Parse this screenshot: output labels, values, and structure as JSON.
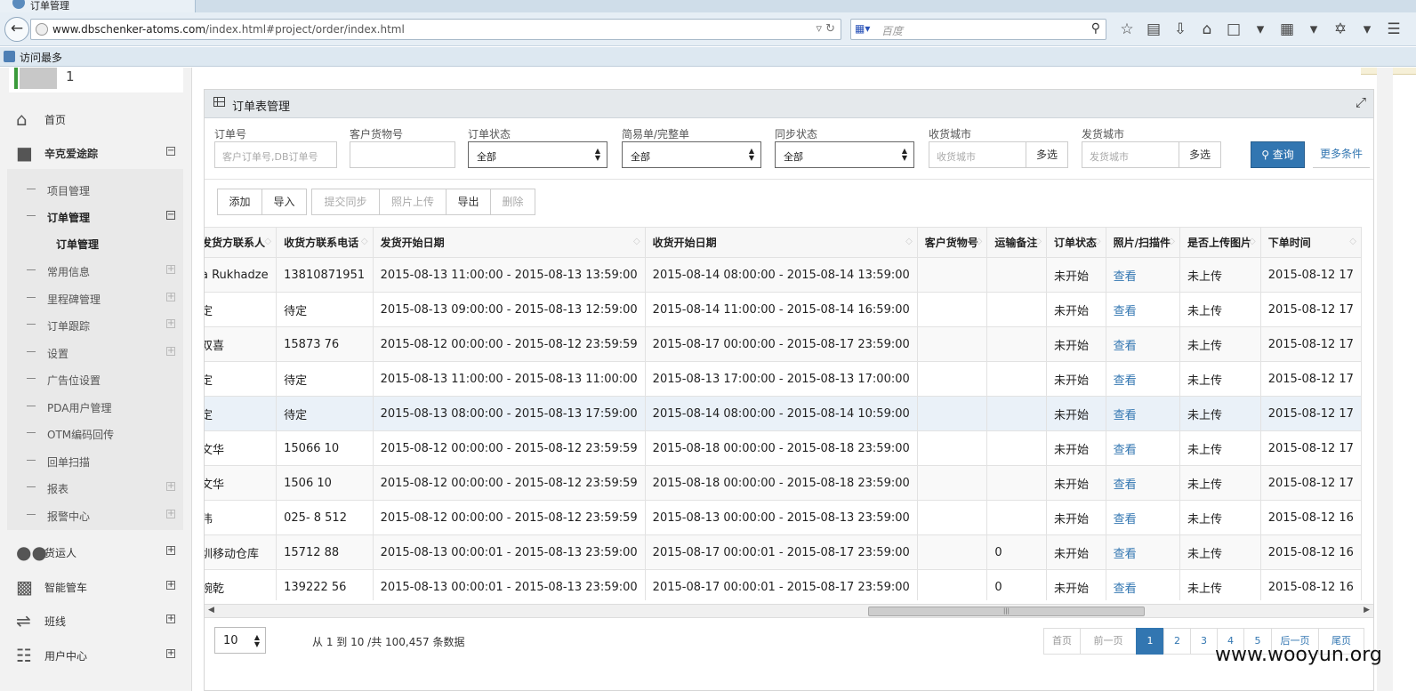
{
  "browser": {
    "tab_title": "订单管理",
    "url": "www.dbschenker-atoms.com/index.html#project/order/index.html",
    "url_host": "www.dbschenker-atoms.com",
    "url_path": "/index.html#project/order/index.html",
    "search_engine_icon": "baidu-paw-icon",
    "search_placeholder": "百度",
    "bookmark_label": "访问最多"
  },
  "sidebar": {
    "user_name": "1",
    "top_items": [
      {
        "label": "首页",
        "icon": "home-icon"
      },
      {
        "label": "辛克爱途踪",
        "icon": "folder-open-icon",
        "toggle": "⊟"
      }
    ],
    "sub_items": [
      {
        "label": "项目管理"
      },
      {
        "label": "订单管理",
        "toggle": "⊟"
      },
      {
        "label": "常用信息",
        "toggle": "+"
      },
      {
        "label": "里程碑管理",
        "toggle": "+"
      },
      {
        "label": "订单跟踪",
        "toggle": "+"
      },
      {
        "label": "设置",
        "toggle": "+"
      },
      {
        "label": "广告位设置"
      },
      {
        "label": "PDA用户管理"
      },
      {
        "label": "OTM编码回传"
      },
      {
        "label": "回单扫描"
      },
      {
        "label": "报表",
        "toggle": "+"
      },
      {
        "label": "报警中心",
        "toggle": "+"
      }
    ],
    "active_subsub": "订单管理",
    "bottom_items": [
      {
        "label": "货运人",
        "icon": "users-icon"
      },
      {
        "label": "智能管车",
        "icon": "truck-icon"
      },
      {
        "label": "班线",
        "icon": "shuffle-icon"
      },
      {
        "label": "用户中心",
        "icon": "sitemap-icon"
      }
    ]
  },
  "panel": {
    "title": "订单表管理"
  },
  "filters": {
    "order_no": {
      "label": "订单号",
      "placeholder": "客户订单号,DB订单号"
    },
    "customer_no": {
      "label": "客户货物号",
      "placeholder": ""
    },
    "order_status": {
      "label": "订单状态",
      "value": "全部"
    },
    "sheet_type": {
      "label": "简易单/完整单",
      "value": "全部"
    },
    "sync_status": {
      "label": "同步状态",
      "value": "全部"
    },
    "recv_city": {
      "label": "收货城市",
      "placeholder": "收货城市",
      "multi": "多选"
    },
    "send_city": {
      "label": "发货城市",
      "placeholder": "发货城市",
      "multi": "多选"
    },
    "query_label": "查询",
    "more_label": "更多条件"
  },
  "toolbar": {
    "add": "添加",
    "import": "导入",
    "submit_sync": "提交同步",
    "photo_upload": "照片上传",
    "export": "导出",
    "delete": "删除"
  },
  "table": {
    "columns": [
      "发货方联系人",
      "收货方联系电话",
      "发货开始日期",
      "收货开始日期",
      "客户货物号",
      "运输备注",
      "订单状态",
      "照片/扫描件",
      "是否上传图片",
      "下单时间"
    ],
    "rows": [
      {
        "contact": "a Rukhadze",
        "phone": "13810871951",
        "ship": "2015-08-13 11:00:00 - 2015-08-13 13:59:00",
        "recv": "2015-08-14 08:00:00 - 2015-08-14 13:59:00",
        "cust": "",
        "note": "",
        "status": "未开始",
        "photo": "查看",
        "uploaded": "未上传",
        "time": "2015-08-12 17"
      },
      {
        "contact": "定",
        "phone": "待定",
        "ship": "2015-08-13 09:00:00 - 2015-08-13 12:59:00",
        "recv": "2015-08-14 11:00:00 - 2015-08-14 16:59:00",
        "cust": "",
        "note": "",
        "status": "未开始",
        "photo": "查看",
        "uploaded": "未上传",
        "time": "2015-08-12 17"
      },
      {
        "contact": "双喜",
        "phone": "15873  76",
        "ship": "2015-08-12 00:00:00 - 2015-08-12 23:59:59",
        "recv": "2015-08-17 00:00:00 - 2015-08-17 23:59:00",
        "cust": "",
        "note": "",
        "status": "未开始",
        "photo": "查看",
        "uploaded": "未上传",
        "time": "2015-08-12 17"
      },
      {
        "contact": "定",
        "phone": "待定",
        "ship": "2015-08-13 11:00:00 - 2015-08-13 11:00:00",
        "recv": "2015-08-13 17:00:00 - 2015-08-13 17:00:00",
        "cust": "",
        "note": "",
        "status": "未开始",
        "photo": "查看",
        "uploaded": "未上传",
        "time": "2015-08-12 17"
      },
      {
        "contact": "定",
        "phone": "待定",
        "ship": "2015-08-13 08:00:00 - 2015-08-13 17:59:00",
        "recv": "2015-08-14 08:00:00 - 2015-08-14 10:59:00",
        "cust": "",
        "note": "",
        "status": "未开始",
        "photo": "查看",
        "uploaded": "未上传",
        "time": "2015-08-12 17"
      },
      {
        "contact": "文华",
        "phone": "15066  10",
        "ship": "2015-08-12 00:00:00 - 2015-08-12 23:59:59",
        "recv": "2015-08-18 00:00:00 - 2015-08-18 23:59:00",
        "cust": "",
        "note": "",
        "status": "未开始",
        "photo": "查看",
        "uploaded": "未上传",
        "time": "2015-08-12 17"
      },
      {
        "contact": "文华",
        "phone": "1506  10",
        "ship": "2015-08-12 00:00:00 - 2015-08-12 23:59:59",
        "recv": "2015-08-18 00:00:00 - 2015-08-18 23:59:00",
        "cust": "",
        "note": "",
        "status": "未开始",
        "photo": "查看",
        "uploaded": "未上传",
        "time": "2015-08-12 17"
      },
      {
        "contact": "伟",
        "phone": "025-  8  512",
        "ship": "2015-08-12 00:00:00 - 2015-08-12 23:59:59",
        "recv": "2015-08-13 00:00:00 - 2015-08-13 23:59:00",
        "cust": "",
        "note": "",
        "status": "未开始",
        "photo": "查看",
        "uploaded": "未上传",
        "time": "2015-08-12 16"
      },
      {
        "contact": "圳移动仓库",
        "phone": "15712  88",
        "ship": "2015-08-13 00:00:01 - 2015-08-13 23:59:00",
        "recv": "2015-08-17 00:00:01 - 2015-08-17 23:59:00",
        "cust": "",
        "note": "0",
        "status": "未开始",
        "photo": "查看",
        "uploaded": "未上传",
        "time": "2015-08-12 16"
      },
      {
        "contact": "婉乾",
        "phone": "139222  56",
        "ship": "2015-08-13 00:00:01 - 2015-08-13 23:59:00",
        "recv": "2015-08-17 00:00:01 - 2015-08-17 23:59:00",
        "cust": "",
        "note": "0",
        "status": "未开始",
        "photo": "查看",
        "uploaded": "未上传",
        "time": "2015-08-12 16"
      }
    ]
  },
  "pager": {
    "page_size": "10",
    "info": "从 1 到 10 /共 100,457 条数据",
    "first": "首页",
    "prev": "前一页",
    "pages": [
      "1",
      "2",
      "3",
      "4",
      "5"
    ],
    "next": "后一页",
    "last": "尾页"
  },
  "watermark": "www.wooyun.org"
}
